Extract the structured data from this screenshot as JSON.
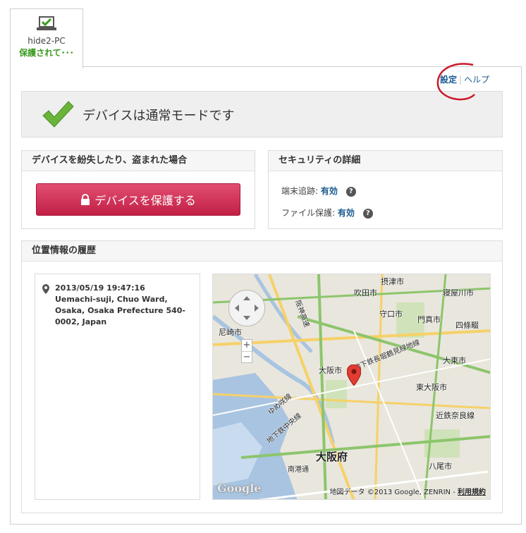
{
  "device_tab": {
    "name": "hide2-PC",
    "status": "保護されて･･･"
  },
  "top_links": {
    "settings": "設定",
    "separator": "|",
    "help": "ヘルプ"
  },
  "status_banner": {
    "message": "デバイスは通常モードです"
  },
  "lost_panel": {
    "title": "デバイスを紛失したり、盗まれた場合",
    "button_label": "デバイスを保護する"
  },
  "security_panel": {
    "title": "セキュリティの詳細",
    "rows": [
      {
        "label": "端末追跡:",
        "value": "有効"
      },
      {
        "label": "ファイル保護:",
        "value": "有効"
      }
    ]
  },
  "history_panel": {
    "title": "位置情報の履歴",
    "locations": [
      {
        "timestamp": "2013/05/19 19:47:16",
        "address": "Uemachi-suji, Chuo Ward, Osaka, Osaka Prefecture 540-0002, Japan"
      }
    ]
  },
  "map": {
    "labels": [
      "摂津市",
      "吹田市",
      "寝屋川市",
      "守口市",
      "門真市",
      "四條畷",
      "尼崎市",
      "大東市",
      "大阪市",
      "東大阪市",
      "大阪府",
      "近鉄奈良線",
      "八尾市",
      "南港通",
      "ゆめ咲線",
      "地下鉄中央線",
      "地下鉄長堀鶴見緑地線",
      "阪神高速"
    ],
    "logo": "Google",
    "credit": "地図データ ©2013 Google, ZENRIN -",
    "terms_link": "利用規約",
    "zoom_in": "+",
    "zoom_out": "−"
  },
  "colors": {
    "accent": "#1a5a92",
    "status_green": "#3a9a1e",
    "protect_button": "#c93457"
  }
}
